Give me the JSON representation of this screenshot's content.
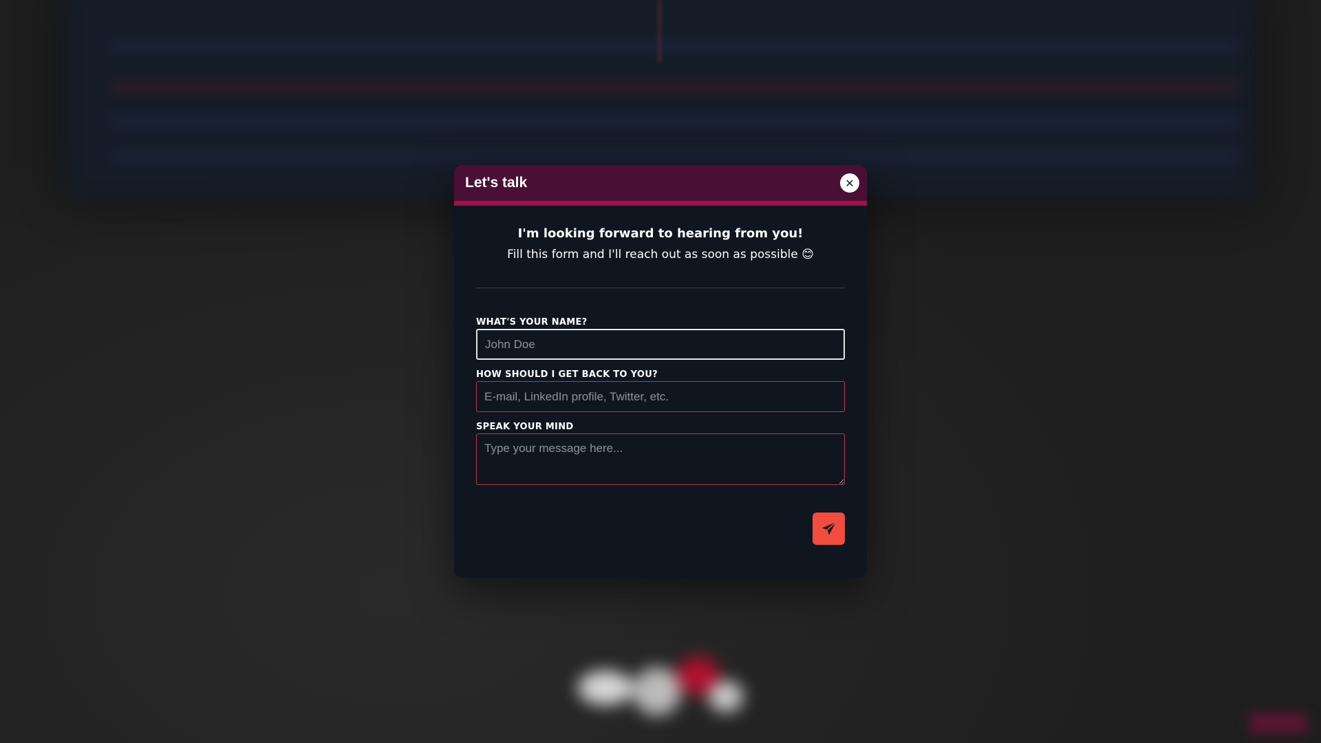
{
  "modal": {
    "title": "Let's talk",
    "close_icon": "close-icon",
    "intro_heading": "I'm looking forward to hearing from you!",
    "intro_text": "Fill this form and I'll reach out as soon as possible 😊"
  },
  "form": {
    "name": {
      "label": "WHAT'S YOUR NAME?",
      "placeholder": "John Doe",
      "value": ""
    },
    "contact": {
      "label": "HOW SHOULD I GET BACK TO YOU?",
      "placeholder": "E-mail, LinkedIn profile, Twitter, etc.",
      "value": ""
    },
    "message": {
      "label": "SPEAK YOUR MIND",
      "placeholder": "Type your message here...",
      "value": ""
    },
    "send_icon": "paper-plane-icon"
  },
  "colors": {
    "header_bg": "#4a0f35",
    "header_border": "#a0124c",
    "modal_bg": "#0f1620",
    "field_border": "#b53a50",
    "send_button": "#f04c3f"
  }
}
